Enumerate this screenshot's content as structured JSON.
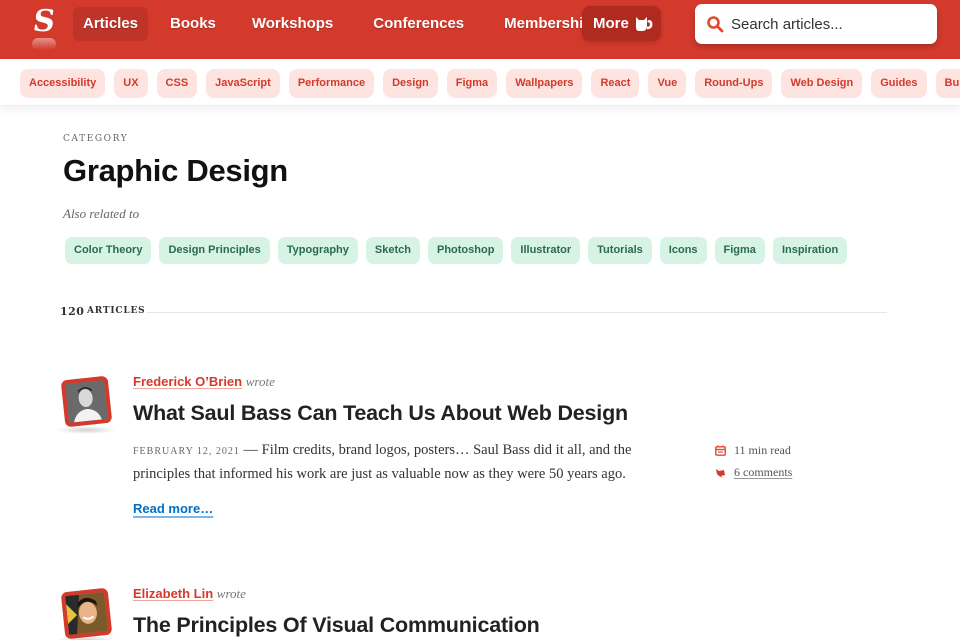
{
  "header": {
    "logo_letter": "S",
    "nav": [
      {
        "label": "Articles",
        "active": true
      },
      {
        "label": "Books",
        "active": false
      },
      {
        "label": "Workshops",
        "active": false
      },
      {
        "label": "Conferences",
        "active": false
      },
      {
        "label": "Membership",
        "active": false
      }
    ],
    "more_label": "More",
    "search_placeholder": "Search articles...",
    "brand_color": "#d33a2c"
  },
  "topic_tags": [
    "Accessibility",
    "UX",
    "CSS",
    "JavaScript",
    "Performance",
    "Design",
    "Figma",
    "Wallpapers",
    "React",
    "Vue",
    "Round-Ups",
    "Web Design",
    "Guides",
    "Business"
  ],
  "category": {
    "label": "CATEGORY",
    "title": "Graphic Design",
    "also_related_label": "Also related to",
    "related": [
      "Color Theory",
      "Design Principles",
      "Typography",
      "Sketch",
      "Photoshop",
      "Illustrator",
      "Tutorials",
      "Icons",
      "Figma",
      "Inspiration"
    ]
  },
  "count": {
    "number": "120",
    "label": "ARTICLES"
  },
  "articles": [
    {
      "author": "Frederick O’Brien",
      "wrote": "wrote",
      "title": "What Saul Bass Can Teach Us About Web Design",
      "date": "February 12, 2021",
      "dash": "—",
      "excerpt": "Film credits, brand logos, posters… Saul Bass did it all, and the principles that informed his work are just as valuable now as they were 50 years ago.",
      "read_more": "Read more…",
      "read_time": "11 min read",
      "comments": "6 comments"
    },
    {
      "author": "Elizabeth Lin",
      "wrote": "wrote",
      "title": "The Principles Of Visual Communication"
    }
  ]
}
